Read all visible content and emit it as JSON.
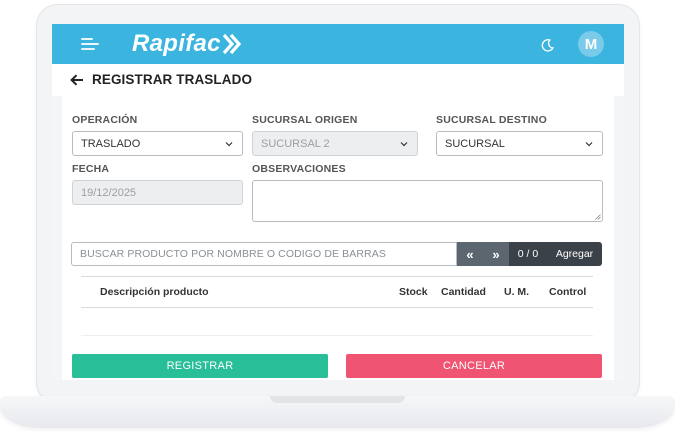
{
  "app": {
    "name": "Rapifac",
    "user_initial": "M"
  },
  "colors": {
    "header": "#3bb5df",
    "primary": "#27be98",
    "danger": "#ef5572",
    "dark": "#3b4148"
  },
  "icons": {
    "menu": "hamburger-icon",
    "theme": "moon-icon",
    "back": "arrow-left-icon",
    "prev": "double-chevron-left-icon",
    "next": "double-chevron-right-icon"
  },
  "page": {
    "title": "REGISTRAR TRASLADO"
  },
  "form": {
    "operacion": {
      "label": "OPERACIÓN",
      "value": "TRASLADO"
    },
    "sucursal_origen": {
      "label": "SUCURSAL ORIGEN",
      "value": "SUCURSAL 2"
    },
    "sucursal_destino": {
      "label": "SUCURSAL DESTINO",
      "value": "SUCURSAL"
    },
    "fecha": {
      "label": "FECHA",
      "value": "19/12/2025"
    },
    "observaciones": {
      "label": "OBSERVACIONES",
      "value": ""
    }
  },
  "search": {
    "placeholder": "BUSCAR PRODUCTO POR NOMBRE O CODIGO DE BARRAS",
    "prev_label": "«",
    "next_label": "»",
    "count": "0 / 0",
    "add_label": "Agregar"
  },
  "table": {
    "headers": [
      "Descripción producto",
      "Stock",
      "Cantidad",
      "U. M.",
      "Control"
    ]
  },
  "actions": {
    "register_label": "REGISTRAR",
    "cancel_label": "CANCELAR"
  }
}
